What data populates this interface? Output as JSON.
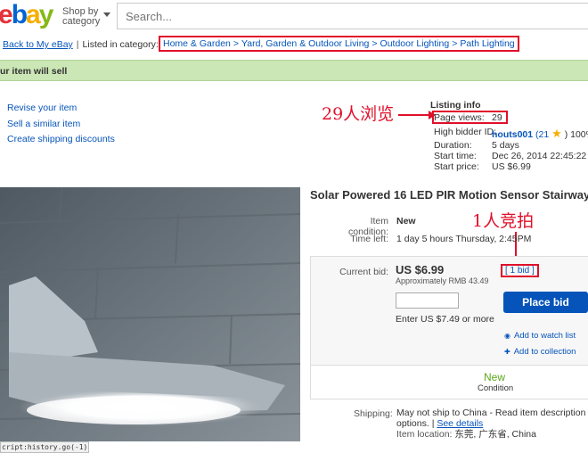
{
  "header": {
    "logo": {
      "e": "e",
      "b": "b",
      "a": "a",
      "y": "y"
    },
    "shop_by_line1": "Shop by",
    "shop_by_line2": "category",
    "search_placeholder": "Search..."
  },
  "breadcrumb_row": {
    "back_link": "Back to My eBay",
    "separator": "|",
    "listed_in": "Listed in category:",
    "crumbs": [
      "Home & Garden",
      "Yard, Garden & Outdoor Living",
      "Outdoor Lighting",
      "Path Lighting"
    ],
    "crumb_separator": ">"
  },
  "banner": {
    "text": "ur item will sell"
  },
  "actions": [
    "Revise your item",
    "Sell a similar item",
    "Create shipping discounts"
  ],
  "annotations": {
    "page_views_note": "29人浏览",
    "bid_note": "1人竞拍"
  },
  "listing_info": {
    "title": "Listing info",
    "page_views_label": "Page views:",
    "page_views_value": "29",
    "high_bidder_label": "High bidder ID:",
    "high_bidder_value": "houts001",
    "high_bidder_score": "(21",
    "high_bidder_tail": ") 100%",
    "duration_label": "Duration:",
    "duration_value": "5 days",
    "start_time_label": "Start time:",
    "start_time_value": "Dec 26, 2014 22:45:22 PS",
    "start_price_label": "Start price:",
    "start_price_value": "US $6.99"
  },
  "item": {
    "title": "Solar Powered 16 LED PIR Motion Sensor Stairway",
    "condition_label": "Item condition:",
    "condition_value": "New",
    "time_left_label": "Time left:",
    "time_left_value": "1 day 5 hours Thursday, 2:45PM",
    "current_bid_label": "Current bid:",
    "current_bid_value": "US $6.99",
    "approx": "Approximately RMB 43.49",
    "bids": "[ 1 bid ]",
    "bid_input_value": "",
    "enter_hint": "Enter US $7.49 or more",
    "place_bid": "Place bid",
    "watch_link": "Add to watch list",
    "collection_link": "Add to collection",
    "cond_badge": "New",
    "cond_badge_label": "Condition",
    "shipping_label": "Shipping:",
    "shipping_line1": "May not ship to China - Read item description or co",
    "shipping_line2_a": "options. |",
    "shipping_line2_link": "See details",
    "location_label": "Item location:",
    "location_value": "东莞, 广东省, China"
  },
  "statusbar": "cript:history.go(-1)",
  "colors": {
    "accent": "#0654ba",
    "annotation": "#e0102a",
    "banner": "#cbe7b5",
    "new_green": "#5ba71b"
  }
}
